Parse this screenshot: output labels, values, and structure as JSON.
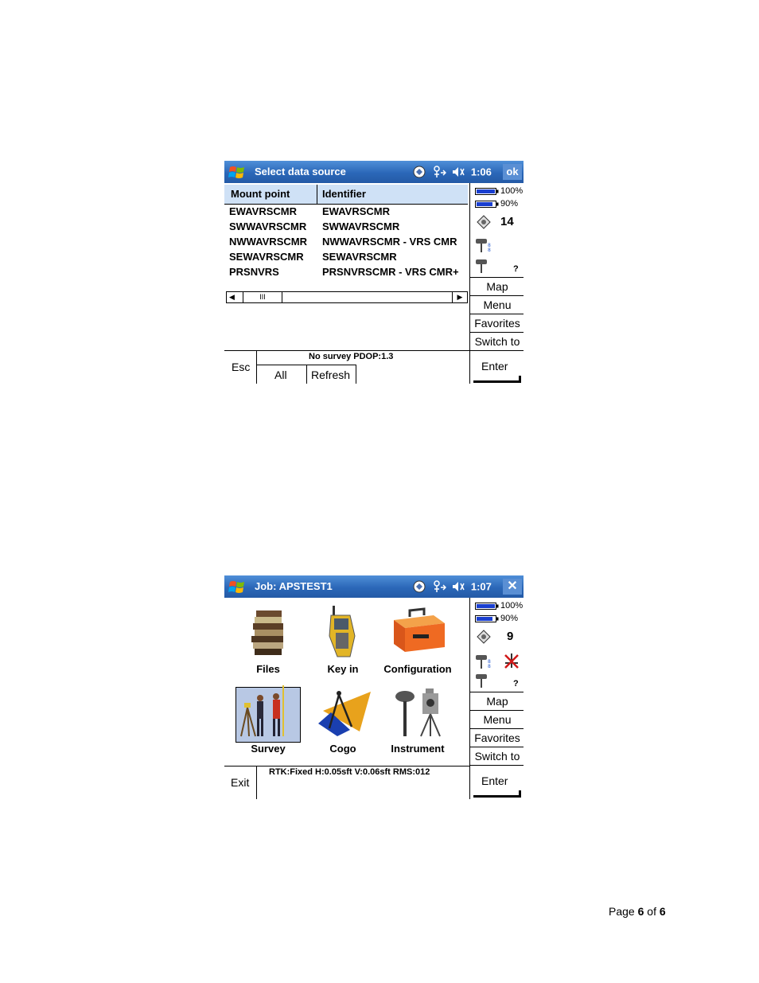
{
  "screen1": {
    "title": "Select data source",
    "clock": "1:06",
    "ok_label": "ok",
    "battery1": "100%",
    "battery2": "90%",
    "satellites": "14",
    "receiver_status": "?",
    "columns": [
      "Mount point",
      "Identifier"
    ],
    "rows": [
      {
        "mount": "EWAVRSCMR",
        "id": "EWAVRSCMR"
      },
      {
        "mount": "SWWAVRSCMR",
        "id": "SWWAVRSCMR"
      },
      {
        "mount": "NWWAVRSCMR",
        "id": "NWWAVRSCMR - VRS CMR"
      },
      {
        "mount": "SEWAVRSCMR",
        "id": "SEWAVRSCMR"
      },
      {
        "mount": "PRSNVRS",
        "id": "PRSNVRSCMR - VRS CMR+"
      }
    ],
    "scroll_thumb": "III",
    "side_buttons": [
      "Map",
      "Menu",
      "Favorites",
      "Switch to"
    ],
    "esc_label": "Esc",
    "status_text": "No survey  PDOP:1.3",
    "all_label": "All",
    "refresh_label": "Refresh",
    "enter_label": "Enter"
  },
  "screen2": {
    "title": "Job: APSTEST1",
    "clock": "1:07",
    "close_label": "✕",
    "battery1": "100%",
    "battery2": "90%",
    "satellites": "9",
    "receiver_status": "?",
    "tiles": [
      "Files",
      "Key in",
      "Configuration",
      "Survey",
      "Cogo",
      "Instrument"
    ],
    "side_buttons": [
      "Map",
      "Menu",
      "Favorites",
      "Switch to"
    ],
    "exit_label": "Exit",
    "status_text": "RTK:Fixed H:0.05sft V:0.06sft RMS:012",
    "enter_label": "Enter"
  },
  "footer": {
    "page_prefix": "Page ",
    "page_num": "6",
    "of_text": " of ",
    "page_total": "6"
  },
  "colors": {
    "titlebar": "#2b67b8",
    "list_header": "#cfe1f6",
    "selected_tile": "#b8c8e4"
  }
}
